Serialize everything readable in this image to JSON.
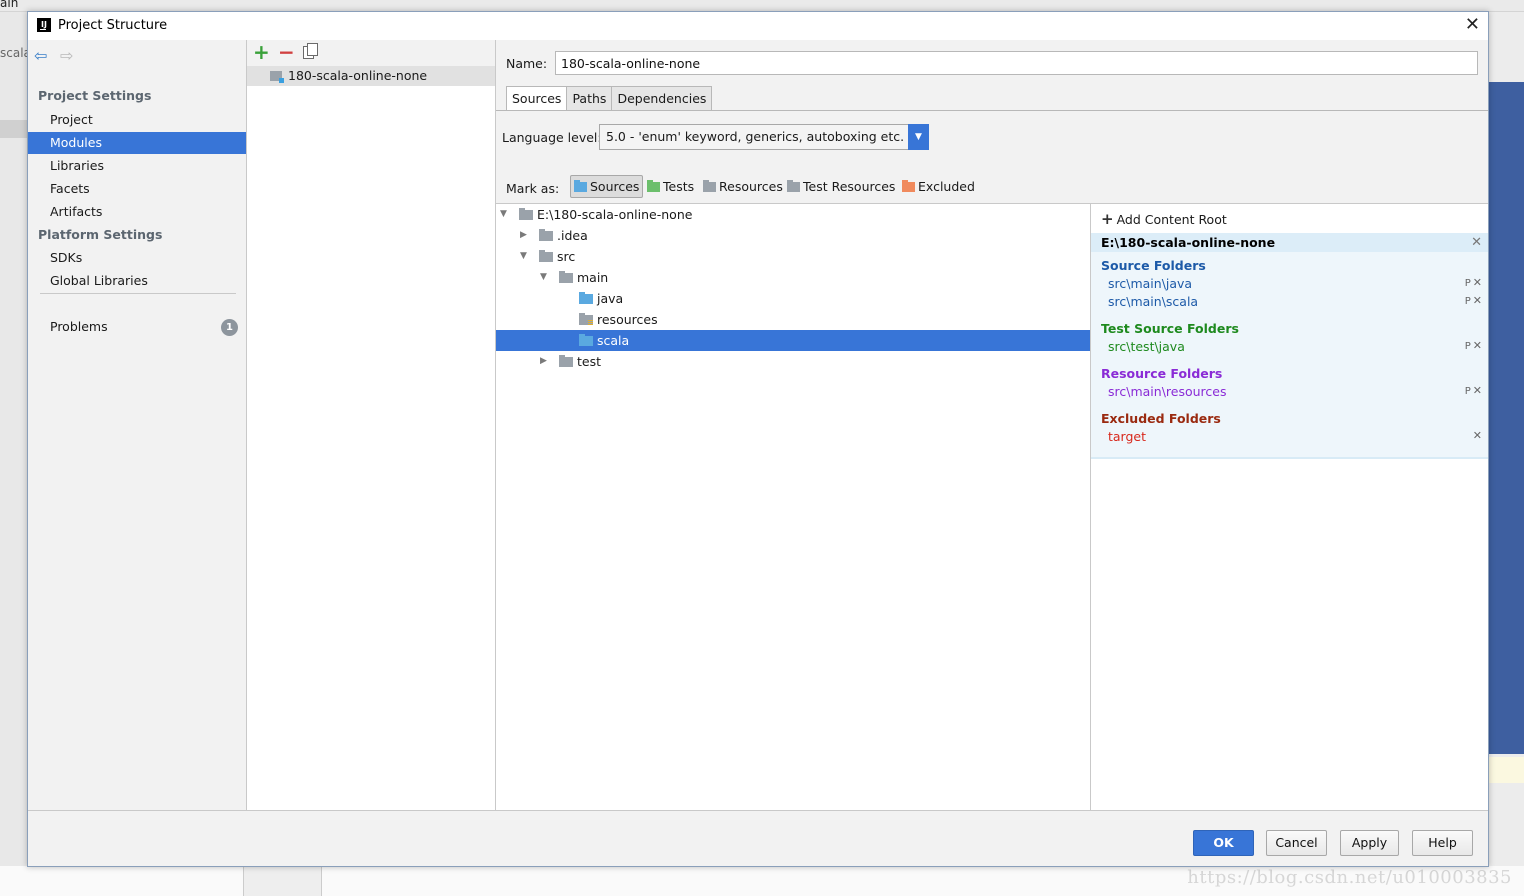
{
  "background": {
    "top_tab": "ain",
    "left_tab": "scala",
    "watermark": "https://blog.csdn.net/u010003835"
  },
  "window": {
    "title": "Project Structure",
    "close_glyph": "✕"
  },
  "nav": {
    "back_glyph": "⇦",
    "forward_glyph": "⇨",
    "project_settings_header": "Project Settings",
    "platform_settings_header": "Platform Settings",
    "project_settings": [
      "Project",
      "Modules",
      "Libraries",
      "Facets",
      "Artifacts"
    ],
    "platform_settings": [
      "SDKs",
      "Global Libraries"
    ],
    "problems_label": "Problems",
    "problems_count": "1",
    "selected": "Modules"
  },
  "modules": {
    "add_glyph": "+",
    "remove_glyph": "−",
    "items": [
      "180-scala-online-none"
    ]
  },
  "module_detail": {
    "name_label": "Name:",
    "name_value": "180-scala-online-none",
    "tabs": [
      "Sources",
      "Paths",
      "Dependencies"
    ],
    "active_tab": "Sources",
    "language_level_label": "Language level:",
    "language_level_value": "5.0 - 'enum' keyword, generics, autoboxing etc.",
    "dropdown_arrow": "▼",
    "mark_as_label": "Mark as:",
    "mark_as": [
      {
        "label": "Sources",
        "color": "#5aa9e0"
      },
      {
        "label": "Tests",
        "color": "#6cbf6c"
      },
      {
        "label": "Resources",
        "color": "#9aa2aa"
      },
      {
        "label": "Test Resources",
        "color": "#9aa2aa"
      },
      {
        "label": "Excluded",
        "color": "#f08a5d"
      }
    ]
  },
  "tree": {
    "expanded_glyph": "▼",
    "collapsed_glyph": "▶",
    "nodes": [
      {
        "label": "E:\\180-scala-online-none",
        "icon": "folder"
      },
      {
        "label": ".idea",
        "icon": "folder"
      },
      {
        "label": "src",
        "icon": "folder"
      },
      {
        "label": "main",
        "icon": "folder"
      },
      {
        "label": "java",
        "icon": "source-folder"
      },
      {
        "label": "resources",
        "icon": "resource-folder"
      },
      {
        "label": "scala",
        "icon": "source-folder"
      },
      {
        "label": "test",
        "icon": "folder"
      }
    ],
    "selected": "scala"
  },
  "content_roots": {
    "add_label": "Add Content Root",
    "add_glyph": "+",
    "root_path": "E:\\180-scala-online-none",
    "remove_glyph": "✕",
    "edit_glyph": "P",
    "source_folders_header": "Source Folders",
    "source_folders": [
      "src\\main\\java",
      "src\\main\\scala"
    ],
    "test_source_folders_header": "Test Source Folders",
    "test_source_folders": [
      "src\\test\\java"
    ],
    "resource_folders_header": "Resource Folders",
    "resource_folders": [
      "src\\main\\resources"
    ],
    "excluded_folders_header": "Excluded Folders",
    "excluded_folders": [
      "target"
    ],
    "colors": {
      "source": "#1d5aa8",
      "test": "#1e8a1e",
      "resource": "#8a2bd6",
      "excluded": "#9a2a10",
      "excluded_path": "#d8281c"
    }
  },
  "footer": {
    "ok": "OK",
    "cancel": "Cancel",
    "apply": "Apply",
    "help": "Help"
  }
}
